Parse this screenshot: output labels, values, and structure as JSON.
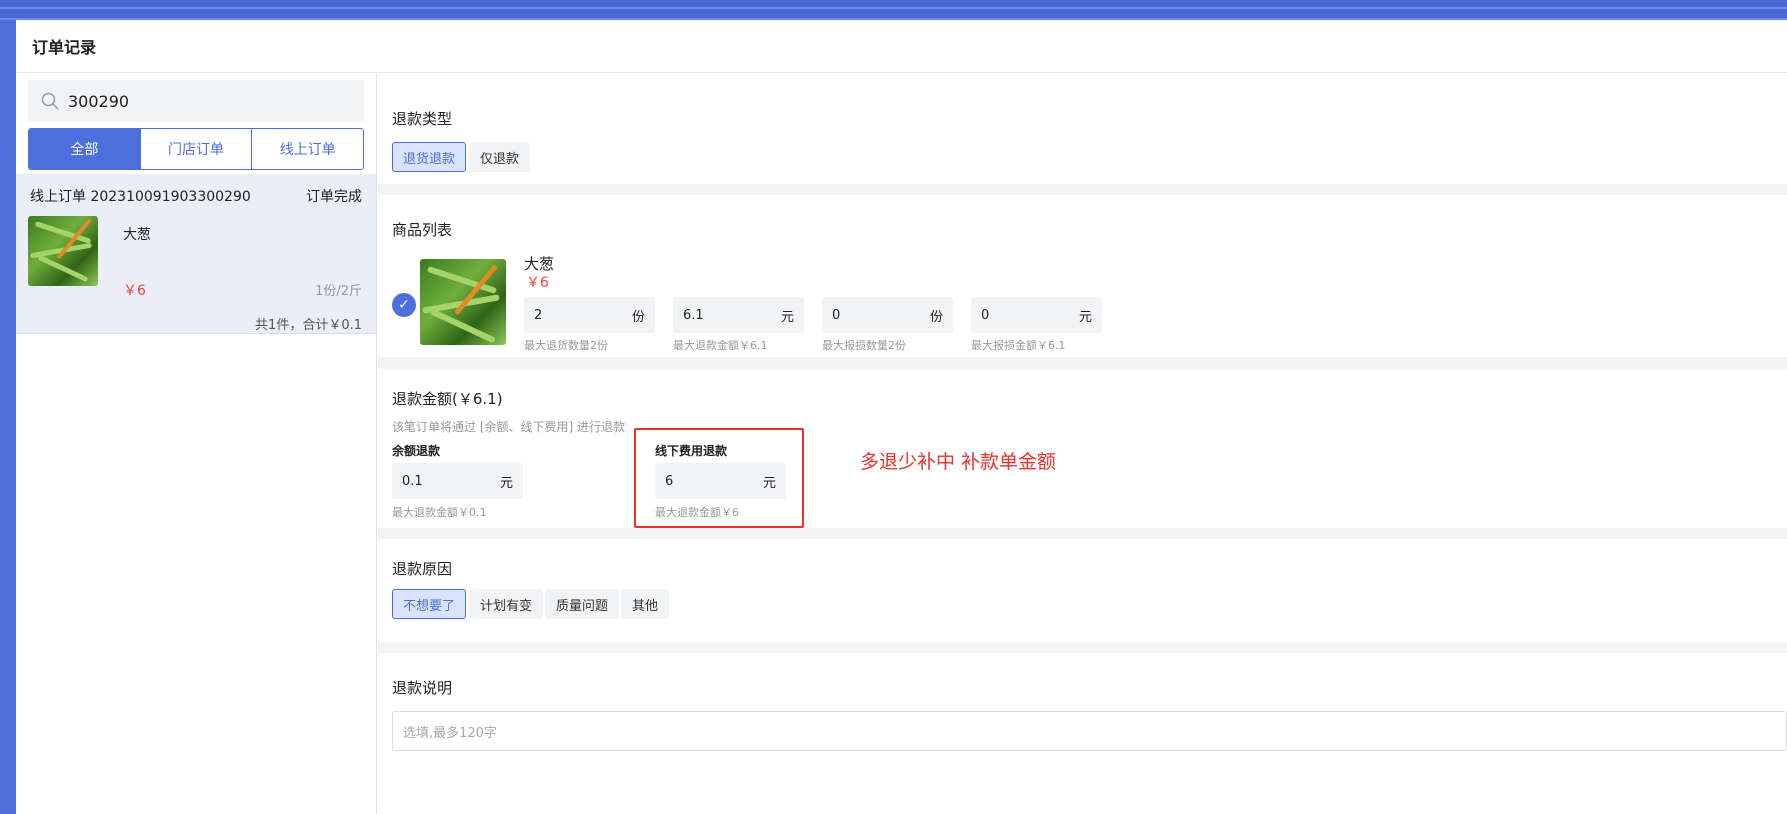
{
  "window": {
    "title": "订单记录"
  },
  "search": {
    "value": "300290"
  },
  "filter_tabs": [
    {
      "label": "全部",
      "active": true
    },
    {
      "label": "门店订单",
      "active": false
    },
    {
      "label": "线上订单",
      "active": false
    }
  ],
  "order": {
    "header": "线上订单 202310091903300290",
    "status": "订单完成",
    "product_name": "大葱",
    "price": "￥6",
    "qty": "1份/2斤",
    "total": "共1件，合计￥0.1"
  },
  "refund_type": {
    "title": "退款类型",
    "options": [
      {
        "label": "退货退款",
        "active": true
      },
      {
        "label": "仅退款",
        "active": false
      }
    ]
  },
  "product_list": {
    "title": "商品列表",
    "name": "大葱",
    "price": "￥6",
    "fields": [
      {
        "value": "2",
        "unit": "份",
        "hint": "最大退货数量2份"
      },
      {
        "value": "6.1",
        "unit": "元",
        "hint": "最大退款金额￥6.1"
      },
      {
        "value": "0",
        "unit": "份",
        "hint": "最大报损数量2份"
      },
      {
        "value": "0",
        "unit": "元",
        "hint": "最大报损金额￥6.1"
      }
    ]
  },
  "refund_amount": {
    "title": "退款金额(￥6.1)",
    "note": "该笔订单将通过 [余额、线下费用] 进行退款",
    "balance_label": "余额退款",
    "balance_value": "0.1",
    "balance_unit": "元",
    "balance_hint": "最大退款金额￥0.1",
    "offline_label": "线下费用退款",
    "offline_value": "6",
    "offline_unit": "元",
    "offline_hint": "最大退款金额￥6",
    "annotation": "多退少补中 补款单金额"
  },
  "refund_reason": {
    "title": "退款原因",
    "options": [
      {
        "label": "不想要了",
        "active": true
      },
      {
        "label": "计划有变",
        "active": false
      },
      {
        "label": "质量问题",
        "active": false
      },
      {
        "label": "其他",
        "active": false
      }
    ]
  },
  "refund_note": {
    "title": "退款说明",
    "placeholder": "选填,最多120字"
  },
  "colors": {
    "accent": "#4d6fdb",
    "price_red": "#f0443a",
    "annotation_red": "#e8312b"
  }
}
